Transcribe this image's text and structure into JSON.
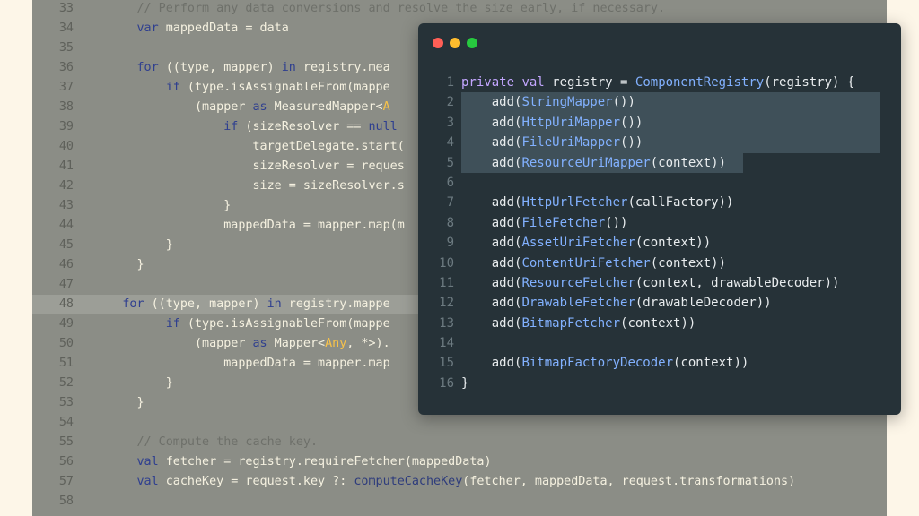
{
  "background_editor": {
    "lines": [
      {
        "n": "33",
        "tokens": [
          {
            "t": "        ",
            "c": "t"
          },
          {
            "t": "// Perform any data conversions and resolve the size early, if necessary.",
            "c": "c"
          }
        ]
      },
      {
        "n": "34",
        "tokens": [
          {
            "t": "        ",
            "c": "t"
          },
          {
            "t": "var",
            "c": "k"
          },
          {
            "t": " mappedData = data",
            "c": "t"
          }
        ]
      },
      {
        "n": "35",
        "tokens": []
      },
      {
        "n": "36",
        "tokens": [
          {
            "t": "        ",
            "c": "t"
          },
          {
            "t": "for",
            "c": "k"
          },
          {
            "t": " ((type, mapper) ",
            "c": "t"
          },
          {
            "t": "in",
            "c": "k"
          },
          {
            "t": " registry.mea",
            "c": "t"
          }
        ]
      },
      {
        "n": "37",
        "tokens": [
          {
            "t": "            ",
            "c": "t"
          },
          {
            "t": "if",
            "c": "k"
          },
          {
            "t": " (type.isAssignableFrom(mappe",
            "c": "t"
          }
        ]
      },
      {
        "n": "38",
        "tokens": [
          {
            "t": "                (mapper ",
            "c": "t"
          },
          {
            "t": "as",
            "c": "k"
          },
          {
            "t": " MeasuredMapper<",
            "c": "t"
          },
          {
            "t": "A",
            "c": "o"
          }
        ]
      },
      {
        "n": "39",
        "tokens": [
          {
            "t": "                    ",
            "c": "t"
          },
          {
            "t": "if",
            "c": "k"
          },
          {
            "t": " (sizeResolver == ",
            "c": "t"
          },
          {
            "t": "null",
            "c": "k"
          }
        ]
      },
      {
        "n": "40",
        "tokens": [
          {
            "t": "                        targetDelegate.start(",
            "c": "t"
          }
        ]
      },
      {
        "n": "41",
        "tokens": [
          {
            "t": "                        sizeResolver = reques",
            "c": "t"
          }
        ]
      },
      {
        "n": "42",
        "tokens": [
          {
            "t": "                        size = sizeResolver.s",
            "c": "t"
          }
        ]
      },
      {
        "n": "43",
        "tokens": [
          {
            "t": "                    }",
            "c": "t"
          }
        ]
      },
      {
        "n": "44",
        "tokens": [
          {
            "t": "                    mappedData = mapper.map(m",
            "c": "t"
          }
        ]
      },
      {
        "n": "45",
        "tokens": [
          {
            "t": "            }",
            "c": "t"
          }
        ]
      },
      {
        "n": "46",
        "tokens": [
          {
            "t": "        }",
            "c": "t"
          }
        ]
      },
      {
        "n": "47",
        "tokens": []
      },
      {
        "n": "48",
        "tokens": [
          {
            "t": "      ",
            "c": "t"
          },
          {
            "t": "for",
            "c": "k"
          },
          {
            "t": " ((type, mapper) ",
            "c": "t"
          },
          {
            "t": "in",
            "c": "k"
          },
          {
            "t": " registry.mappe",
            "c": "t"
          }
        ],
        "highlight": true
      },
      {
        "n": "49",
        "tokens": [
          {
            "t": "            ",
            "c": "t"
          },
          {
            "t": "if",
            "c": "k"
          },
          {
            "t": " (type.isAssignableFrom(mappe",
            "c": "t"
          }
        ]
      },
      {
        "n": "50",
        "tokens": [
          {
            "t": "                (mapper ",
            "c": "t"
          },
          {
            "t": "as",
            "c": "k"
          },
          {
            "t": " Mapper<",
            "c": "t"
          },
          {
            "t": "Any",
            "c": "o"
          },
          {
            "t": ", *>).",
            "c": "t"
          }
        ]
      },
      {
        "n": "51",
        "tokens": [
          {
            "t": "                    mappedData = mapper.map",
            "c": "t"
          }
        ]
      },
      {
        "n": "52",
        "tokens": [
          {
            "t": "            }",
            "c": "t"
          }
        ]
      },
      {
        "n": "53",
        "tokens": [
          {
            "t": "        }",
            "c": "t"
          }
        ]
      },
      {
        "n": "54",
        "tokens": []
      },
      {
        "n": "55",
        "tokens": [
          {
            "t": "        ",
            "c": "t"
          },
          {
            "t": "// Compute the cache key.",
            "c": "c"
          }
        ]
      },
      {
        "n": "56",
        "tokens": [
          {
            "t": "        ",
            "c": "t"
          },
          {
            "t": "val",
            "c": "k"
          },
          {
            "t": " fetcher = registry.requireFetcher(mappedData)",
            "c": "t"
          }
        ]
      },
      {
        "n": "57",
        "tokens": [
          {
            "t": "        ",
            "c": "t"
          },
          {
            "t": "val",
            "c": "k"
          },
          {
            "t": " cacheKey = request.key ?: ",
            "c": "t"
          },
          {
            "t": "computeCacheKey",
            "c": "f"
          },
          {
            "t": "(fetcher, mappedData, request.transformations)",
            "c": "t"
          }
        ]
      },
      {
        "n": "58",
        "tokens": []
      }
    ]
  },
  "window": {
    "controls": {
      "close_color": "#ff5f56",
      "minimize_color": "#ffbd2e",
      "maximize_color": "#27c93f"
    },
    "selection_color": "#3f5059",
    "lines": [
      {
        "n": "1",
        "tokens": [
          {
            "t": "private",
            "c": "k"
          },
          {
            "t": " ",
            "c": "t"
          },
          {
            "t": "val",
            "c": "k"
          },
          {
            "t": " registry = ",
            "c": "t"
          },
          {
            "t": "ComponentRegistry",
            "c": "f"
          },
          {
            "t": "(registry) {",
            "c": "t"
          }
        ]
      },
      {
        "n": "2",
        "tokens": [
          {
            "t": "    add(",
            "c": "t"
          },
          {
            "t": "StringMapper",
            "c": "f"
          },
          {
            "t": "())",
            "c": "t"
          }
        ],
        "selected": true
      },
      {
        "n": "3",
        "tokens": [
          {
            "t": "    add(",
            "c": "t"
          },
          {
            "t": "HttpUriMapper",
            "c": "f"
          },
          {
            "t": "())",
            "c": "t"
          }
        ],
        "selected": true
      },
      {
        "n": "4",
        "tokens": [
          {
            "t": "    add(",
            "c": "t"
          },
          {
            "t": "FileUriMapper",
            "c": "f"
          },
          {
            "t": "())",
            "c": "t"
          }
        ],
        "selected": true
      },
      {
        "n": "5",
        "tokens": [
          {
            "t": "    add(",
            "c": "t"
          },
          {
            "t": "ResourceUriMapper",
            "c": "f"
          },
          {
            "t": "(context))",
            "c": "t"
          }
        ],
        "selected": true,
        "partial": true
      },
      {
        "n": "6",
        "tokens": []
      },
      {
        "n": "7",
        "tokens": [
          {
            "t": "    add(",
            "c": "t"
          },
          {
            "t": "HttpUrlFetcher",
            "c": "f"
          },
          {
            "t": "(callFactory))",
            "c": "t"
          }
        ]
      },
      {
        "n": "8",
        "tokens": [
          {
            "t": "    add(",
            "c": "t"
          },
          {
            "t": "FileFetcher",
            "c": "f"
          },
          {
            "t": "())",
            "c": "t"
          }
        ]
      },
      {
        "n": "9",
        "tokens": [
          {
            "t": "    add(",
            "c": "t"
          },
          {
            "t": "AssetUriFetcher",
            "c": "f"
          },
          {
            "t": "(context))",
            "c": "t"
          }
        ]
      },
      {
        "n": "10",
        "tokens": [
          {
            "t": "    add(",
            "c": "t"
          },
          {
            "t": "ContentUriFetcher",
            "c": "f"
          },
          {
            "t": "(context))",
            "c": "t"
          }
        ]
      },
      {
        "n": "11",
        "tokens": [
          {
            "t": "    add(",
            "c": "t"
          },
          {
            "t": "ResourceFetcher",
            "c": "f"
          },
          {
            "t": "(context, drawableDecoder))",
            "c": "t"
          }
        ]
      },
      {
        "n": "12",
        "tokens": [
          {
            "t": "    add(",
            "c": "t"
          },
          {
            "t": "DrawableFetcher",
            "c": "f"
          },
          {
            "t": "(drawableDecoder))",
            "c": "t"
          }
        ]
      },
      {
        "n": "13",
        "tokens": [
          {
            "t": "    add(",
            "c": "t"
          },
          {
            "t": "BitmapFetcher",
            "c": "f"
          },
          {
            "t": "(context))",
            "c": "t"
          }
        ]
      },
      {
        "n": "14",
        "tokens": []
      },
      {
        "n": "15",
        "tokens": [
          {
            "t": "    add(",
            "c": "t"
          },
          {
            "t": "BitmapFactoryDecoder",
            "c": "f"
          },
          {
            "t": "(context))",
            "c": "t"
          }
        ]
      },
      {
        "n": "16",
        "tokens": [
          {
            "t": "}",
            "c": "t"
          }
        ]
      }
    ]
  }
}
